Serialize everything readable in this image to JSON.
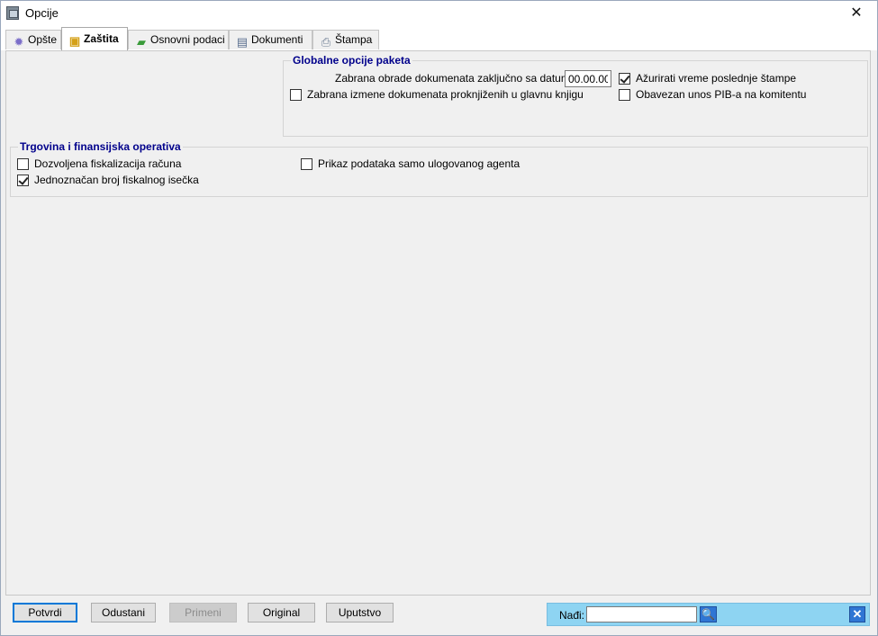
{
  "window": {
    "title": "Opcije",
    "close_glyph": "✕"
  },
  "tabs": [
    {
      "label": "Opšte",
      "icon": "gear-icon",
      "active": false
    },
    {
      "label": "Zaštita",
      "icon": "lock-icon",
      "active": true
    },
    {
      "label": "Osnovni podaci",
      "icon": "folder-icon",
      "active": false
    },
    {
      "label": "Dokumenti",
      "icon": "document-icon",
      "active": false
    },
    {
      "label": "Štampa",
      "icon": "printer-icon",
      "active": false
    }
  ],
  "global_options": {
    "title": "Globalne opcije paketa",
    "lock_date_label": "Zabrana obrade dokumenata zaključno sa datumom:",
    "lock_date_value": "00.00.00",
    "update_print_time": {
      "label": "Ažurirati vreme poslednje štampe",
      "checked": true
    },
    "no_edit_posted": {
      "label": "Zabrana izmene dokumenata proknjiženih u glavnu knjigu",
      "checked": false
    },
    "require_pib": {
      "label": "Obavezan unos PIB-a na komitentu",
      "checked": false
    }
  },
  "trade_ops": {
    "title": "Trgovina i finansijska operativa",
    "allow_fiscalization": {
      "label": "Dozvoljena fiskalizacija računa",
      "checked": false
    },
    "unique_receipt_no": {
      "label": "Jednoznačan broj fiskalnog isečka",
      "checked": true
    },
    "agent_only_data": {
      "label": "Prikaz podataka samo ulogovanog agenta",
      "checked": false
    }
  },
  "buttons": {
    "confirm": "Potvrdi",
    "cancel": "Odustani",
    "apply": "Primeni",
    "original": "Original",
    "help": "Uputstvo"
  },
  "find": {
    "label": "Nađi:",
    "value": "",
    "search_glyph": "🔍",
    "close_glyph": "✕"
  },
  "colors": {
    "group_title": "#00008b",
    "find_bar": "#8ed4f2",
    "accent": "#0078d7"
  }
}
